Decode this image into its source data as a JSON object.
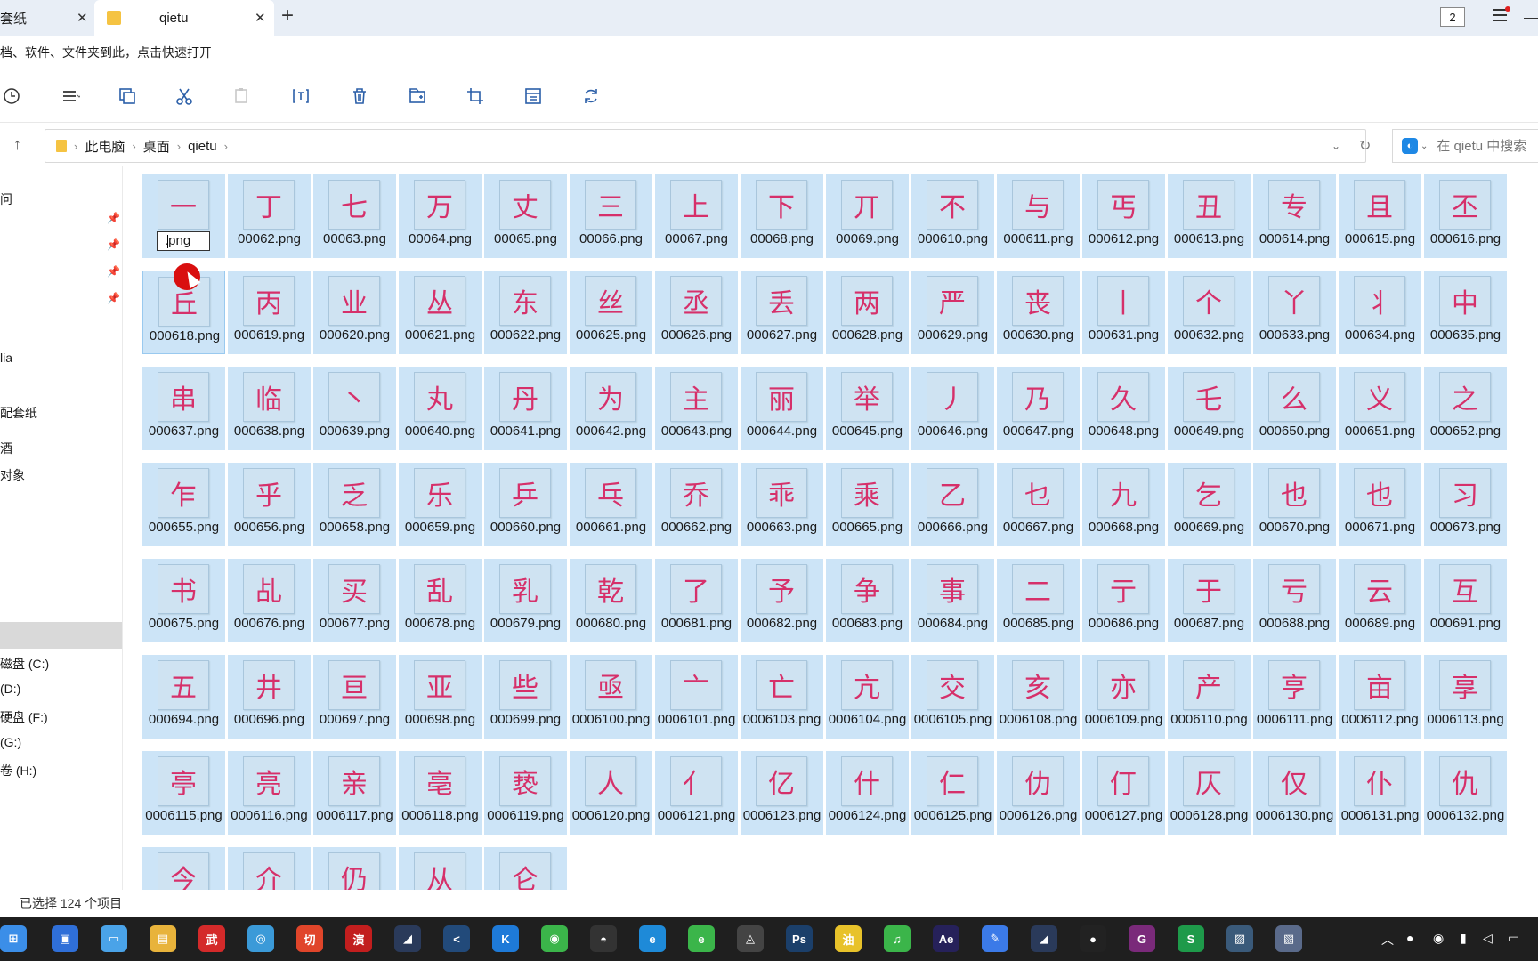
{
  "tabs": [
    {
      "label": "套纸",
      "close": "✕"
    },
    {
      "label": "qietu",
      "close": "✕"
    }
  ],
  "new_tab": "+",
  "window_count": "2",
  "quickbar_text": "档、软件、文件夹到此，点击快速打开",
  "breadcrumb": [
    "此电脑",
    "桌面",
    "qietu"
  ],
  "search_placeholder": "在 qietu 中搜索",
  "sidebar": {
    "items": [
      "问",
      "lia",
      "配套纸",
      "酒",
      "对象",
      "磁盘 (C:)",
      "(D:)",
      "硬盘 (F:)",
      "(G:)",
      "卷 (H:)"
    ]
  },
  "rename_value": ".png",
  "files": [
    {
      "char": "一",
      "name": ".png"
    },
    {
      "char": "丁",
      "name": "00062.png"
    },
    {
      "char": "七",
      "name": "00063.png"
    },
    {
      "char": "万",
      "name": "00064.png"
    },
    {
      "char": "丈",
      "name": "00065.png"
    },
    {
      "char": "三",
      "name": "00066.png"
    },
    {
      "char": "上",
      "name": "00067.png"
    },
    {
      "char": "下",
      "name": "00068.png"
    },
    {
      "char": "丌",
      "name": "00069.png"
    },
    {
      "char": "不",
      "name": "000610.png"
    },
    {
      "char": "与",
      "name": "000611.png"
    },
    {
      "char": "丐",
      "name": "000612.png"
    },
    {
      "char": "丑",
      "name": "000613.png"
    },
    {
      "char": "专",
      "name": "000614.png"
    },
    {
      "char": "且",
      "name": "000615.png"
    },
    {
      "char": "丕",
      "name": "000616.png"
    },
    {
      "char": "丘",
      "name": "000618.png"
    },
    {
      "char": "丙",
      "name": "000619.png"
    },
    {
      "char": "业",
      "name": "000620.png"
    },
    {
      "char": "丛",
      "name": "000621.png"
    },
    {
      "char": "东",
      "name": "000622.png"
    },
    {
      "char": "丝",
      "name": "000625.png"
    },
    {
      "char": "丞",
      "name": "000626.png"
    },
    {
      "char": "丢",
      "name": "000627.png"
    },
    {
      "char": "两",
      "name": "000628.png"
    },
    {
      "char": "严",
      "name": "000629.png"
    },
    {
      "char": "丧",
      "name": "000630.png"
    },
    {
      "char": "丨",
      "name": "000631.png"
    },
    {
      "char": "个",
      "name": "000632.png"
    },
    {
      "char": "丫",
      "name": "000633.png"
    },
    {
      "char": "丬",
      "name": "000634.png"
    },
    {
      "char": "中",
      "name": "000635.png"
    },
    {
      "char": "串",
      "name": "000637.png"
    },
    {
      "char": "临",
      "name": "000638.png"
    },
    {
      "char": "丶",
      "name": "000639.png"
    },
    {
      "char": "丸",
      "name": "000640.png"
    },
    {
      "char": "丹",
      "name": "000641.png"
    },
    {
      "char": "为",
      "name": "000642.png"
    },
    {
      "char": "主",
      "name": "000643.png"
    },
    {
      "char": "丽",
      "name": "000644.png"
    },
    {
      "char": "举",
      "name": "000645.png"
    },
    {
      "char": "丿",
      "name": "000646.png"
    },
    {
      "char": "乃",
      "name": "000647.png"
    },
    {
      "char": "久",
      "name": "000648.png"
    },
    {
      "char": "乇",
      "name": "000649.png"
    },
    {
      "char": "么",
      "name": "000650.png"
    },
    {
      "char": "义",
      "name": "000651.png"
    },
    {
      "char": "之",
      "name": "000652.png"
    },
    {
      "char": "乍",
      "name": "000655.png"
    },
    {
      "char": "乎",
      "name": "000656.png"
    },
    {
      "char": "乏",
      "name": "000658.png"
    },
    {
      "char": "乐",
      "name": "000659.png"
    },
    {
      "char": "乒",
      "name": "000660.png"
    },
    {
      "char": "乓",
      "name": "000661.png"
    },
    {
      "char": "乔",
      "name": "000662.png"
    },
    {
      "char": "乖",
      "name": "000663.png"
    },
    {
      "char": "乘",
      "name": "000665.png"
    },
    {
      "char": "乙",
      "name": "000666.png"
    },
    {
      "char": "乜",
      "name": "000667.png"
    },
    {
      "char": "九",
      "name": "000668.png"
    },
    {
      "char": "乞",
      "name": "000669.png"
    },
    {
      "char": "也",
      "name": "000670.png"
    },
    {
      "char": "也",
      "name": "000671.png"
    },
    {
      "char": "习",
      "name": "000673.png"
    },
    {
      "char": "书",
      "name": "000675.png"
    },
    {
      "char": "乩",
      "name": "000676.png"
    },
    {
      "char": "买",
      "name": "000677.png"
    },
    {
      "char": "乱",
      "name": "000678.png"
    },
    {
      "char": "乳",
      "name": "000679.png"
    },
    {
      "char": "乾",
      "name": "000680.png"
    },
    {
      "char": "了",
      "name": "000681.png"
    },
    {
      "char": "予",
      "name": "000682.png"
    },
    {
      "char": "争",
      "name": "000683.png"
    },
    {
      "char": "事",
      "name": "000684.png"
    },
    {
      "char": "二",
      "name": "000685.png"
    },
    {
      "char": "亍",
      "name": "000686.png"
    },
    {
      "char": "于",
      "name": "000687.png"
    },
    {
      "char": "亏",
      "name": "000688.png"
    },
    {
      "char": "云",
      "name": "000689.png"
    },
    {
      "char": "互",
      "name": "000691.png"
    },
    {
      "char": "五",
      "name": "000694.png"
    },
    {
      "char": "井",
      "name": "000696.png"
    },
    {
      "char": "亘",
      "name": "000697.png"
    },
    {
      "char": "亚",
      "name": "000698.png"
    },
    {
      "char": "些",
      "name": "000699.png"
    },
    {
      "char": "亟",
      "name": "0006100.png"
    },
    {
      "char": "亠",
      "name": "0006101.png"
    },
    {
      "char": "亡",
      "name": "0006103.png"
    },
    {
      "char": "亢",
      "name": "0006104.png"
    },
    {
      "char": "交",
      "name": "0006105.png"
    },
    {
      "char": "亥",
      "name": "0006108.png"
    },
    {
      "char": "亦",
      "name": "0006109.png"
    },
    {
      "char": "产",
      "name": "0006110.png"
    },
    {
      "char": "亨",
      "name": "0006111.png"
    },
    {
      "char": "亩",
      "name": "0006112.png"
    },
    {
      "char": "享",
      "name": "0006113.png"
    },
    {
      "char": "亭",
      "name": "0006115.png"
    },
    {
      "char": "亮",
      "name": "0006116.png"
    },
    {
      "char": "亲",
      "name": "0006117.png"
    },
    {
      "char": "亳",
      "name": "0006118.png"
    },
    {
      "char": "亵",
      "name": "0006119.png"
    },
    {
      "char": "人",
      "name": "0006120.png"
    },
    {
      "char": "亻",
      "name": "0006121.png"
    },
    {
      "char": "亿",
      "name": "0006123.png"
    },
    {
      "char": "什",
      "name": "0006124.png"
    },
    {
      "char": "仁",
      "name": "0006125.png"
    },
    {
      "char": "仂",
      "name": "0006126.png"
    },
    {
      "char": "仃",
      "name": "0006127.png"
    },
    {
      "char": "仄",
      "name": "0006128.png"
    },
    {
      "char": "仅",
      "name": "0006130.png"
    },
    {
      "char": "仆",
      "name": "0006131.png"
    },
    {
      "char": "仇",
      "name": "0006132.png"
    },
    {
      "char": "今",
      "name": ""
    },
    {
      "char": "介",
      "name": ""
    },
    {
      "char": "仍",
      "name": ""
    },
    {
      "char": "从",
      "name": ""
    },
    {
      "char": "仑",
      "name": ""
    }
  ],
  "status_text": "已选择 124 个项目",
  "taskbar_icons": [
    {
      "name": "start",
      "color": "#3b8ee8",
      "glyph": "⊞"
    },
    {
      "name": "app-1",
      "color": "#2f6fd8",
      "glyph": "▣"
    },
    {
      "name": "explorer",
      "color": "#4aa3e8",
      "glyph": "▭"
    },
    {
      "name": "folder",
      "color": "#e8b33b",
      "glyph": "▤"
    },
    {
      "name": "app-wu",
      "color": "#d42a2a",
      "glyph": "武"
    },
    {
      "name": "app-ball",
      "color": "#3b9ad8",
      "glyph": "◎"
    },
    {
      "name": "app-qie",
      "color": "#e0452a",
      "glyph": "切"
    },
    {
      "name": "app-yan",
      "color": "#c21e1e",
      "glyph": "演"
    },
    {
      "name": "app-dark",
      "color": "#2a3a5a",
      "glyph": "◢"
    },
    {
      "name": "app-k1",
      "color": "#224a7a",
      "glyph": "<"
    },
    {
      "name": "app-k2",
      "color": "#1e7ad8",
      "glyph": "K"
    },
    {
      "name": "wechat",
      "color": "#3bb54a",
      "glyph": "◉"
    },
    {
      "name": "qq",
      "color": "#333333",
      "glyph": "◓"
    },
    {
      "name": "edge",
      "color": "#1e8ad8",
      "glyph": "e"
    },
    {
      "name": "app-green",
      "color": "#3bb54a",
      "glyph": "e"
    },
    {
      "name": "app-fox",
      "color": "#444444",
      "glyph": "◬"
    },
    {
      "name": "photoshop",
      "color": "#1b3f6a",
      "glyph": "Ps"
    },
    {
      "name": "app-you",
      "color": "#e8c22a",
      "glyph": "油"
    },
    {
      "name": "app-music",
      "color": "#3bb54a",
      "glyph": "♫"
    },
    {
      "name": "after-effects",
      "color": "#26215a",
      "glyph": "Ae"
    },
    {
      "name": "app-pen",
      "color": "#3b7ae8",
      "glyph": "✎"
    },
    {
      "name": "app-dark2",
      "color": "#2a3a5a",
      "glyph": "◢"
    },
    {
      "name": "record",
      "color": "#222222",
      "glyph": "●"
    },
    {
      "name": "app-pdf",
      "color": "#7a2a7a",
      "glyph": "G"
    },
    {
      "name": "app-s",
      "color": "#1e9a4a",
      "glyph": "S"
    },
    {
      "name": "app-img",
      "color": "#3a5a7a",
      "glyph": "▨"
    },
    {
      "name": "app-last",
      "color": "#5a6a8a",
      "glyph": "▧"
    }
  ]
}
